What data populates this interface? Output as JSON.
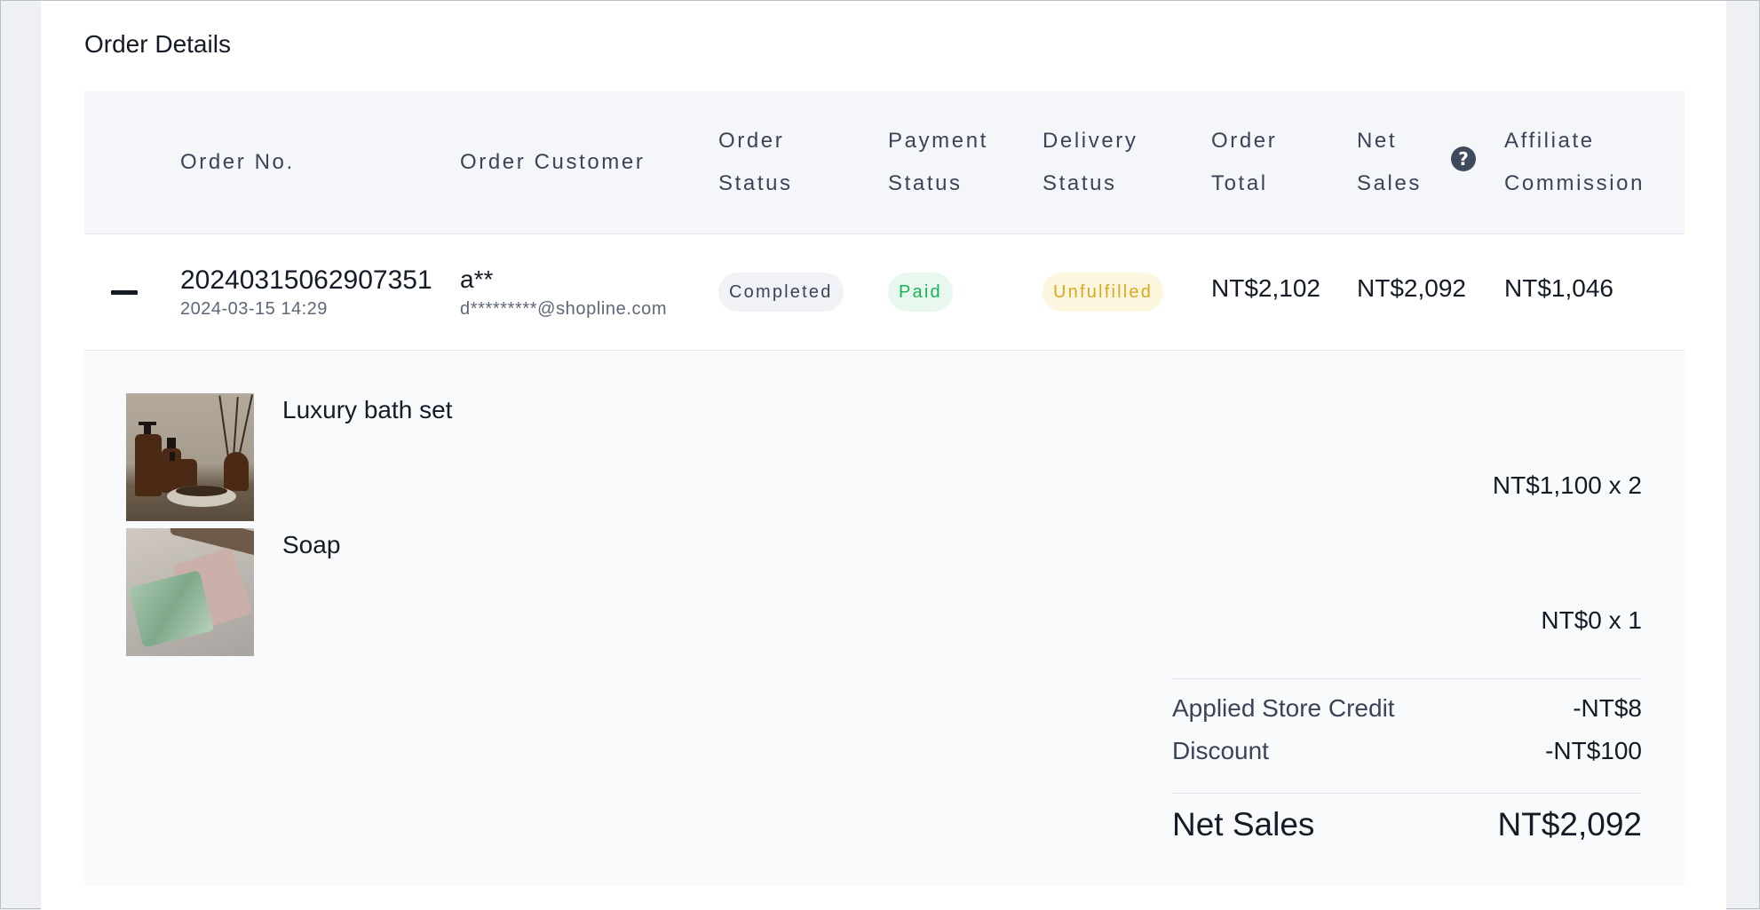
{
  "card": {
    "title": "Order Details"
  },
  "table": {
    "headers": {
      "order_no": "Order No.",
      "order_customer": "Order Customer",
      "order_status": [
        "Order",
        "Status"
      ],
      "payment_status": [
        "Payment",
        "Status"
      ],
      "delivery_status": [
        "Delivery",
        "Status"
      ],
      "order_total": [
        "Order",
        "Total"
      ],
      "net_sales": [
        "Net",
        "Sales"
      ],
      "affiliate_commission": [
        "Affiliate",
        "Commission"
      ]
    },
    "help_icon_glyph": "?"
  },
  "order": {
    "order_no": "20240315062907351",
    "date": "2024-03-15 14:29",
    "customer_name": "a**",
    "customer_email": "d*********@shopline.com",
    "order_status": "Completed",
    "payment_status": "Paid",
    "delivery_status": "Unfulfilled",
    "order_total": "NT$2,102",
    "net_sales": "NT$2,092",
    "affiliate_commission": "NT$1,046"
  },
  "items": [
    {
      "name": "Luxury bath set",
      "price": "NT$1,100 x 2",
      "thumb_icon": "bath-set-photo"
    },
    {
      "name": "Soap",
      "price": "NT$0 x 1",
      "thumb_icon": "soap-photo"
    }
  ],
  "summary": {
    "store_credit_label": "Applied Store Credit",
    "store_credit_value": "-NT$8",
    "discount_label": "Discount",
    "discount_value": "-NT$100",
    "net_sales_label": "Net Sales",
    "net_sales_value": "NT$2,092"
  },
  "colors": {
    "paid": "#18b358",
    "unfulfilled": "#d9a920",
    "header_bg": "#f4f6f9"
  }
}
